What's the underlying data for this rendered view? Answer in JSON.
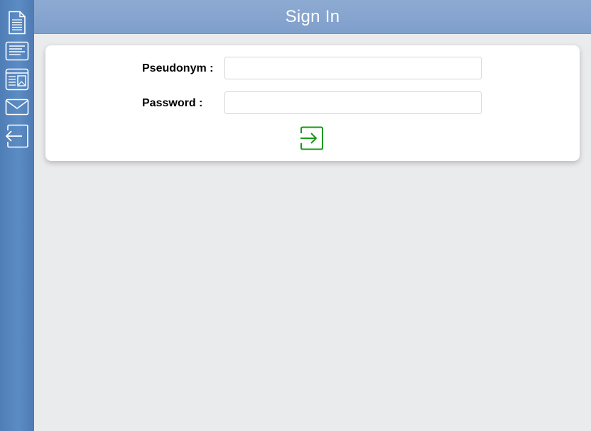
{
  "header": {
    "title": "Sign In"
  },
  "sidebar": {
    "items": [
      {
        "icon": "document-icon"
      },
      {
        "icon": "text-lines-icon"
      },
      {
        "icon": "newspaper-icon"
      },
      {
        "icon": "mail-icon"
      },
      {
        "icon": "logout-icon"
      }
    ]
  },
  "form": {
    "pseudonym_label": "Pseudonym :",
    "pseudonym_value": "",
    "password_label": "Password :",
    "password_value": "",
    "submit_icon": "login-icon"
  },
  "colors": {
    "sidebar": "#5282bb",
    "header": "#87a6cf",
    "background": "#eaebed",
    "card": "#ffffff",
    "accent_green": "#169a16"
  }
}
